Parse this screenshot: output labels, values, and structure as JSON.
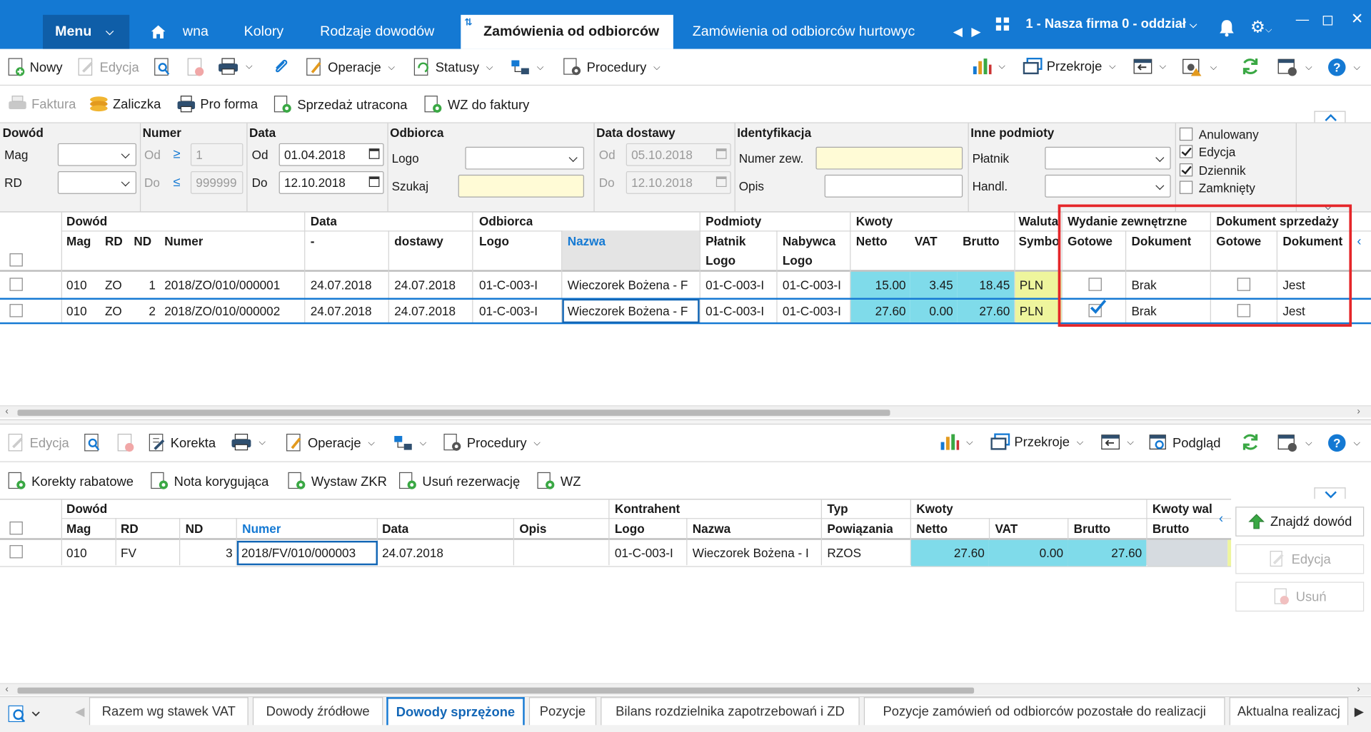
{
  "topbar": {
    "menu_label": "Menu",
    "tabs": [
      "wna",
      "Kolory",
      "Rodzaje dowodów",
      "Zamówienia od odbiorców",
      "Zamówienia od odbiorców hurtowyc"
    ],
    "company": "1 - Nasza firma 0 - oddział"
  },
  "toolbar1": {
    "nowy": "Nowy",
    "edycja": "Edycja",
    "operacje": "Operacje",
    "statusy": "Statusy",
    "procedury": "Procedury",
    "przekroje": "Przekroje"
  },
  "toolbar2": {
    "faktura": "Faktura",
    "zaliczka": "Zaliczka",
    "pro_forma": "Pro forma",
    "sprzedaz": "Sprzedaż utracona",
    "wz": "WZ do faktury"
  },
  "filter": {
    "dowod": "Dowód",
    "mag": "Mag",
    "rd": "RD",
    "numer": "Numer",
    "od": "Od",
    "do": "Do",
    "numer_od": "1",
    "numer_do": "999999",
    "data": "Data",
    "data_od": "01.04.2018",
    "data_do": "12.10.2018",
    "odbiorca": "Odbiorca",
    "logo": "Logo",
    "szukaj": "Szukaj",
    "data_dostawy": "Data dostawy",
    "dd_od": "05.10.2018",
    "dd_do": "12.10.2018",
    "identyfikacja": "Identyfikacja",
    "numer_zew": "Numer zew.",
    "opis": "Opis",
    "inne": "Inne podmioty",
    "platnik": "Płatnik",
    "handl": "Handl.",
    "checks": [
      {
        "label": "Anulowany",
        "checked": false
      },
      {
        "label": "Edycja",
        "checked": true
      },
      {
        "label": "Dziennik",
        "checked": true
      },
      {
        "label": "Zamknięty",
        "checked": false
      }
    ]
  },
  "grid1": {
    "groups": {
      "dowod": "Dowód",
      "data": "Data",
      "odbiorca": "Odbiorca",
      "podmioty": "Podmioty",
      "kwoty": "Kwoty",
      "waluta": "Waluta",
      "wydanie": "Wydanie zewnętrzne",
      "dokument": "Dokument sprzedaży"
    },
    "cols": {
      "mag": "Mag",
      "rd": "RD",
      "nd": "ND",
      "numer": "Numer",
      "data": "-",
      "dostawy": "dostawy",
      "logo": "Logo",
      "nazwa": "Nazwa",
      "platnik": "Płatnik",
      "platnik2": "Logo",
      "nabywca": "Nabywca",
      "nabywca2": "Logo",
      "netto": "Netto",
      "vat": "VAT",
      "brutto": "Brutto",
      "symbol": "Symbo",
      "gotowe1": "Gotowe",
      "dok1": "Dokument",
      "gotowe2": "Gotowe",
      "dok2": "Dokument"
    },
    "rows": [
      {
        "mag": "010",
        "rd": "ZO",
        "nd": "1",
        "numer": "2018/ZO/010/000001",
        "data": "24.07.2018",
        "dostawy": "24.07.2018",
        "logo": "01-C-003-I",
        "nazwa": "Wieczorek Bożena - F",
        "platnik": "01-C-003-I",
        "nabywca": "01-C-003-I",
        "netto": "15.00",
        "vat": "3.45",
        "brutto": "18.45",
        "waluta": "PLN",
        "wz_gotowe": false,
        "wz_dok": "Brak",
        "ds_gotowe": false,
        "ds_dok": "Jest"
      },
      {
        "mag": "010",
        "rd": "ZO",
        "nd": "2",
        "numer": "2018/ZO/010/000002",
        "data": "24.07.2018",
        "dostawy": "24.07.2018",
        "logo": "01-C-003-I",
        "nazwa": "Wieczorek Bożena - F",
        "platnik": "01-C-003-I",
        "nabywca": "01-C-003-I",
        "netto": "27.60",
        "vat": "0.00",
        "brutto": "27.60",
        "waluta": "PLN",
        "wz_gotowe": true,
        "wz_dok": "Brak",
        "ds_gotowe": false,
        "ds_dok": "Jest"
      }
    ]
  },
  "toolbar3": {
    "edycja": "Edycja",
    "korekta": "Korekta",
    "operacje": "Operacje",
    "procedury": "Procedury",
    "przekroje": "Przekroje",
    "podglad": "Podgląd"
  },
  "toolbar4": {
    "korekty": "Korekty rabatowe",
    "nota": "Nota korygująca",
    "zkr": "Wystaw ZKR",
    "usun_rez": "Usuń rezerwację",
    "wz": "WZ"
  },
  "grid2": {
    "groups": {
      "dowod": "Dowód",
      "kontrahent": "Kontrahent",
      "typ": "Typ",
      "kwoty": "Kwoty",
      "kwoty_wal": "Kwoty wal"
    },
    "cols": {
      "mag": "Mag",
      "rd": "RD",
      "nd": "ND",
      "numer": "Numer",
      "data": "Data",
      "opis": "Opis",
      "logo": "Logo",
      "nazwa": "Nazwa",
      "powiazania": "Powiązania",
      "netto": "Netto",
      "vat": "VAT",
      "brutto": "Brutto",
      "brutto_wal": "Brutto"
    },
    "rows": [
      {
        "mag": "010",
        "rd": "FV",
        "nd": "3",
        "numer": "2018/FV/010/000003",
        "data": "24.07.2018",
        "opis": "",
        "logo": "01-C-003-I",
        "nazwa": "Wieczorek Bożena - I",
        "typ": "RZOS",
        "netto": "27.60",
        "vat": "0.00",
        "brutto": "27.60"
      }
    ]
  },
  "side_buttons": {
    "znajdz": "Znajdź dowód",
    "edycja": "Edycja",
    "usun": "Usuń"
  },
  "bottom_tabs": [
    "Razem wg stawek VAT",
    "Dowody źródłowe",
    "Dowody sprzężone",
    "Pozycje",
    "Bilans rozdzielnika zapotrzebowań i ZD",
    "Pozycje zamówień od odbiorców pozostałe do realizacji",
    "Aktualna realizacj"
  ],
  "colors": {
    "accent": "#1479d3",
    "highlight": "#e5262a",
    "cyan": "#7fdbea",
    "yellow": "#eef59d"
  }
}
